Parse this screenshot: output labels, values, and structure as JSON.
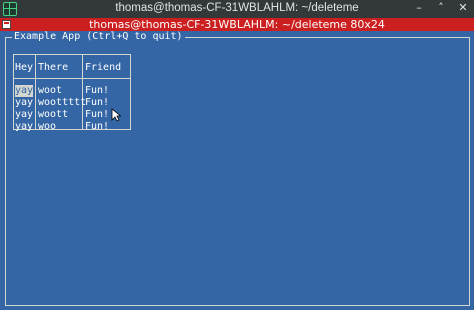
{
  "window": {
    "title": "thomas@thomas-CF-31WBLAHLM: ~/deleteme",
    "controls": [
      "–",
      "˄",
      "✕"
    ],
    "icon": "terminal-grid-icon"
  },
  "terminal_window": {
    "title": "thomas@thomas-CF-31WBLAHLM: ~/deleteme 80x24",
    "icon": "terminal-icon"
  },
  "app": {
    "title": "Example App (Ctrl+Q to quit)",
    "table": {
      "columns": [
        "Hey",
        "There",
        "Friend"
      ],
      "rows": [
        [
          "yay",
          "woot",
          "Fun!"
        ],
        [
          "yay",
          "woottttt",
          "Fun!"
        ],
        [
          "yay",
          "woott",
          "Fun!"
        ],
        [
          "yay",
          "woo",
          "Fun!"
        ]
      ],
      "selected_cell": "yay"
    }
  },
  "colors": {
    "terminal_background": "#3465a4",
    "terminal_titlebar": "#cc1f1f",
    "window_titlebar": "#33393b",
    "foreground": "#ffffff",
    "selection_background": "#d3d7cf"
  }
}
